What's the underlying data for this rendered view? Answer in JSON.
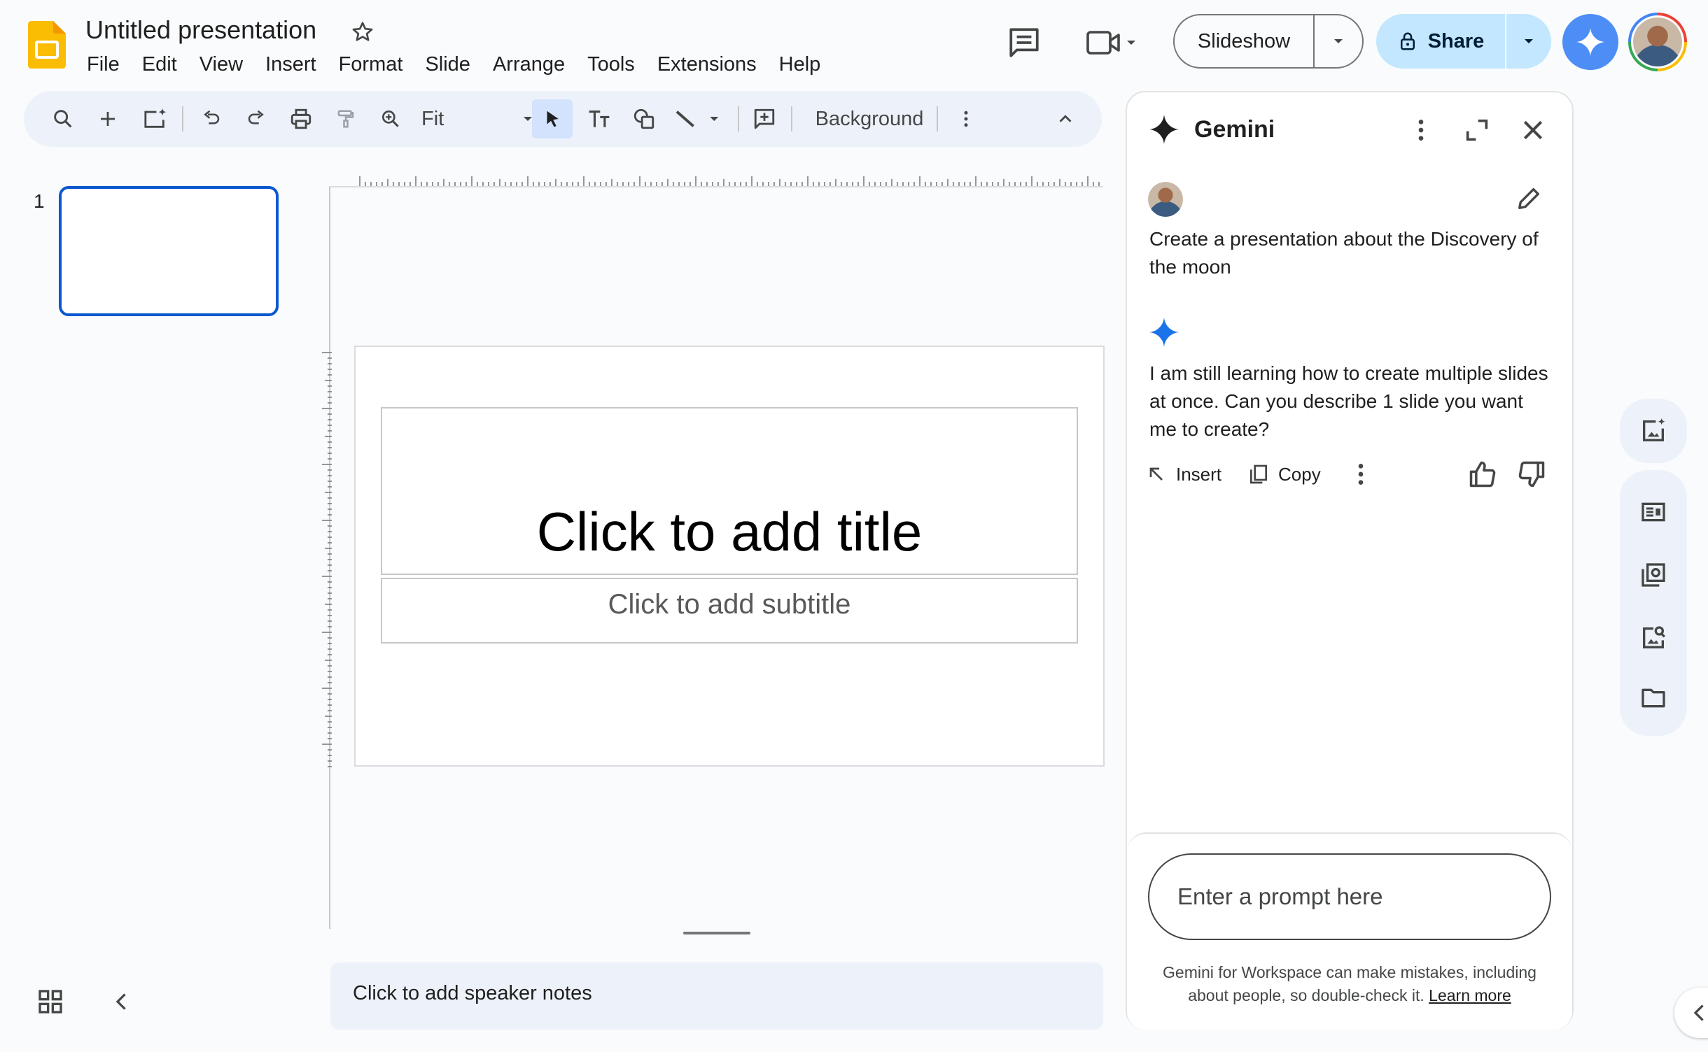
{
  "header": {
    "doc_title": "Untitled presentation",
    "menu": [
      "File",
      "Edit",
      "View",
      "Insert",
      "Format",
      "Slide",
      "Arrange",
      "Tools",
      "Extensions",
      "Help"
    ],
    "slideshow_label": "Slideshow",
    "share_label": "Share",
    "colors": {
      "share_bg": "#c2e7ff",
      "gemini_btn": "#4c8df6",
      "app_logo": "#fbbc04"
    }
  },
  "toolbar": {
    "zoom_label": "Fit",
    "background_label": "Background"
  },
  "filmstrip": {
    "slide_number": "1"
  },
  "slide": {
    "title_placeholder": "Click to add title",
    "subtitle_placeholder": "Click to add subtitle"
  },
  "notes": {
    "placeholder": "Click to add speaker notes"
  },
  "gemini": {
    "title": "Gemini",
    "user_prompt": "Create a presentation about the Discovery of the moon",
    "reply": "I am still learning how to create multiple slides at once. Can you describe 1 slide you want me to create?",
    "insert_label": "Insert",
    "copy_label": "Copy",
    "input_placeholder": "Enter a prompt here",
    "disclaimer": "Gemini for Workspace can make mistakes, including about people, so double-check it.",
    "learn_more": "Learn more",
    "colors": {
      "accent": "#1a73e8"
    }
  }
}
